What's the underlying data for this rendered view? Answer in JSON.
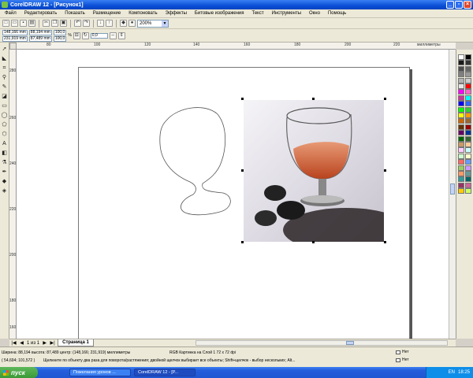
{
  "window": {
    "title": "CorelDRAW 12 - [Рисунок1]",
    "buttons": [
      "_",
      "▫",
      "×"
    ]
  },
  "menu": {
    "items": [
      "Файл",
      "Редактировать",
      "Показать",
      "Размещение",
      "Компоновать",
      "Эффекты",
      "Битовые изображения",
      "Текст",
      "Инструменты",
      "Окно",
      "Помощь"
    ]
  },
  "toolbar": {
    "zoom": "200%",
    "rotation": "0,0"
  },
  "property_bar": {
    "x": "148,166 mm",
    "y": "231,919 mm",
    "width": "88,194 mm",
    "height": "87,489 mm",
    "scale_x": "100,0",
    "scale_y": "100,0",
    "pct": "%"
  },
  "rulers": {
    "unit": "миллиметры",
    "h_ticks": [
      "80",
      "100",
      "120",
      "140",
      "160",
      "180",
      "200",
      "220"
    ],
    "v_ticks": [
      "280",
      "260",
      "240",
      "220",
      "200",
      "180",
      "160"
    ]
  },
  "page_nav": {
    "counter": "1 из 1",
    "tab_label": "Страница 1"
  },
  "status": {
    "line1": "Ширина: 88,194  высота: 87,489  центр: (148,166; 231,919)  миллиметры",
    "bitmap_info": "RGB Картинка на Слой 1 72 x 72 dpi",
    "line2": "( 54,694; 101,572 )",
    "hint": "Щелкните по объекту два раза для поворота/растяжения; двойной щелчок выбирает все объекты; Shift+щелчок - выбор нескольких; Alt...",
    "fill_none": "Нет",
    "outline_none": "Нет"
  },
  "taskbar": {
    "start_label": "пуск",
    "tasks": [
      "Пожелания уроков ...",
      "CorelDRAW 12 - [Р..."
    ],
    "lang": "EN",
    "time": "18:25"
  },
  "palette": {
    "colors": [
      "#ffffff",
      "#000000",
      "#1a1a1a",
      "#333333",
      "#4d4d4d",
      "#666666",
      "#808080",
      "#999999",
      "#b3b3b3",
      "#cccccc",
      "#e6e6e6",
      "#ff0000",
      "#ff00ff",
      "#ff66cc",
      "#cc3399",
      "#00ffff",
      "#0000ff",
      "#3366ff",
      "#00ff00",
      "#33cc33",
      "#ffff00",
      "#ff9900",
      "#cc6600",
      "#996633",
      "#663300",
      "#990000",
      "#660066",
      "#003399",
      "#006600",
      "#336633",
      "#cc9966",
      "#ffcc99",
      "#ffccff",
      "#ccffff",
      "#ccffcc",
      "#ffffcc",
      "#ff6666",
      "#6699ff",
      "#99cc66",
      "#cc99ff",
      "#ff9966",
      "#669999",
      "#339999",
      "#006666",
      "#993366",
      "#cc6699",
      "#ffcc00",
      "#ccff66"
    ]
  }
}
